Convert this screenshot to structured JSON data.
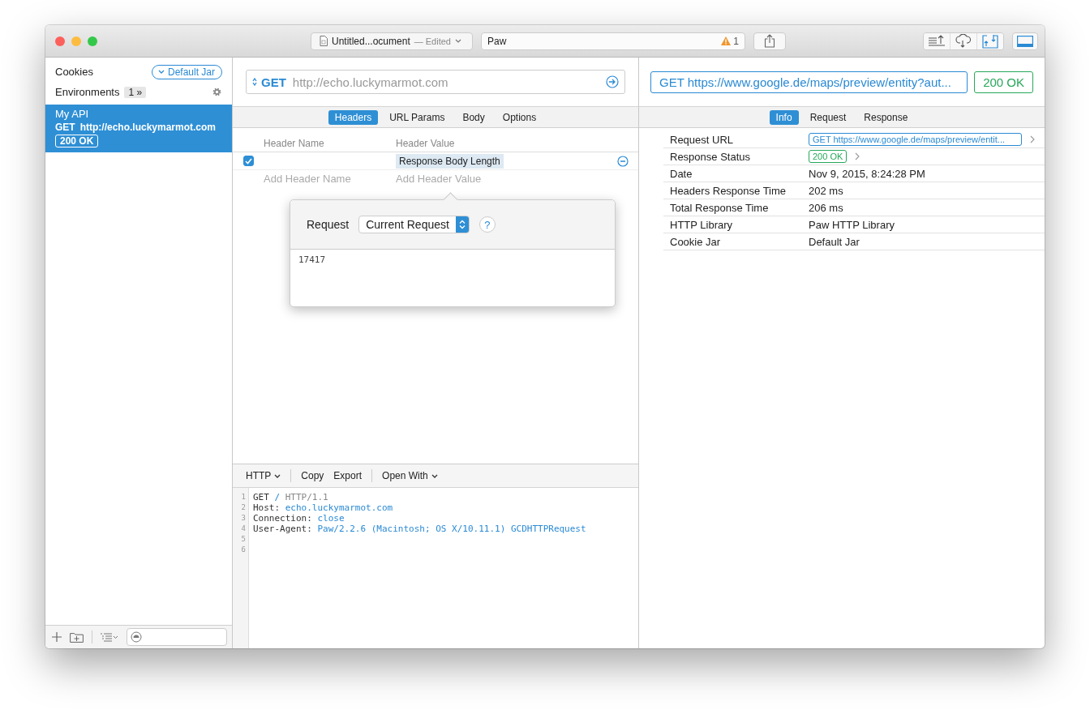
{
  "window": {
    "document_title": "Untitled...ocument",
    "document_state": "— Edited",
    "search_value": "Paw",
    "warning_count": "1"
  },
  "sidebar": {
    "cookies_label": "Cookies",
    "cookie_jar": "Default Jar",
    "environments_label": "Environments",
    "environments_count": "1 »",
    "requests": [
      {
        "name": "My API",
        "method": "GET",
        "url": "http://echo.luckymarmot.com",
        "status": "200 OK",
        "selected": true
      }
    ]
  },
  "request": {
    "method": "GET",
    "url": "http://echo.luckymarmot.com",
    "tabs": [
      {
        "label": "Headers",
        "selected": true
      },
      {
        "label": "URL Params",
        "selected": false
      },
      {
        "label": "Body",
        "selected": false
      },
      {
        "label": "Options",
        "selected": false
      }
    ],
    "columns": [
      "Header Name",
      "Header Value"
    ],
    "headers": [
      {
        "checked": true,
        "value": "Response Body Length"
      }
    ],
    "new_header": {
      "name_placeholder": "Add Header Name",
      "value_placeholder": "Add Header Value"
    },
    "popover": {
      "label": "Request",
      "select_value": "Current Request",
      "help": "?",
      "preview": "17417"
    }
  },
  "code": {
    "toolbar": [
      {
        "label": "HTTP",
        "dropdown": true
      },
      {
        "label": "Copy",
        "dropdown": false
      },
      {
        "label": "Export",
        "dropdown": false
      },
      {
        "label": "Open With",
        "dropdown": true
      }
    ],
    "lines": [
      {
        "number": "1",
        "segments": [
          {
            "text": "GET",
            "kind": "plain"
          },
          {
            "text": " / ",
            "kind": "value"
          },
          {
            "text": "HTTP/1.1",
            "kind": "muted"
          }
        ]
      },
      {
        "number": "2",
        "segments": [
          {
            "text": "Host: ",
            "kind": "plain"
          },
          {
            "text": "echo.luckymarmot.com",
            "kind": "value"
          }
        ]
      },
      {
        "number": "3",
        "segments": [
          {
            "text": "Connection: ",
            "kind": "plain"
          },
          {
            "text": "close",
            "kind": "value"
          }
        ]
      },
      {
        "number": "4",
        "segments": [
          {
            "text": "User-Agent: ",
            "kind": "plain"
          },
          {
            "text": "Paw/2.2.6 (Macintosh; OS X/10.11.1) GCDHTTPRequest",
            "kind": "value"
          }
        ]
      },
      {
        "number": "5"
      },
      {
        "number": "6"
      }
    ]
  },
  "response": {
    "method": "GET",
    "url": "https://www.google.de/maps/preview/entity?aut...",
    "status": "200 OK",
    "tabs": [
      {
        "label": "Info",
        "selected": true
      },
      {
        "label": "Request",
        "selected": false
      },
      {
        "label": "Response",
        "selected": false
      }
    ],
    "info": [
      {
        "label": "Request URL",
        "kind": "request",
        "method": "GET",
        "value": "https://www.google.de/maps/preview/entit..."
      },
      {
        "label": "Response Status",
        "kind": "status",
        "value": "200 OK"
      },
      {
        "label": "Date",
        "kind": "text",
        "value": "Nov 9, 2015, 8:24:28 PM"
      },
      {
        "label": "Headers Response Time",
        "kind": "text",
        "value": "202 ms"
      },
      {
        "label": "Total Response Time",
        "kind": "text",
        "value": "206 ms"
      },
      {
        "label": "HTTP Library",
        "kind": "text",
        "value": "Paw HTTP Library"
      },
      {
        "label": "Cookie Jar",
        "kind": "text",
        "value": "Default Jar"
      }
    ]
  }
}
